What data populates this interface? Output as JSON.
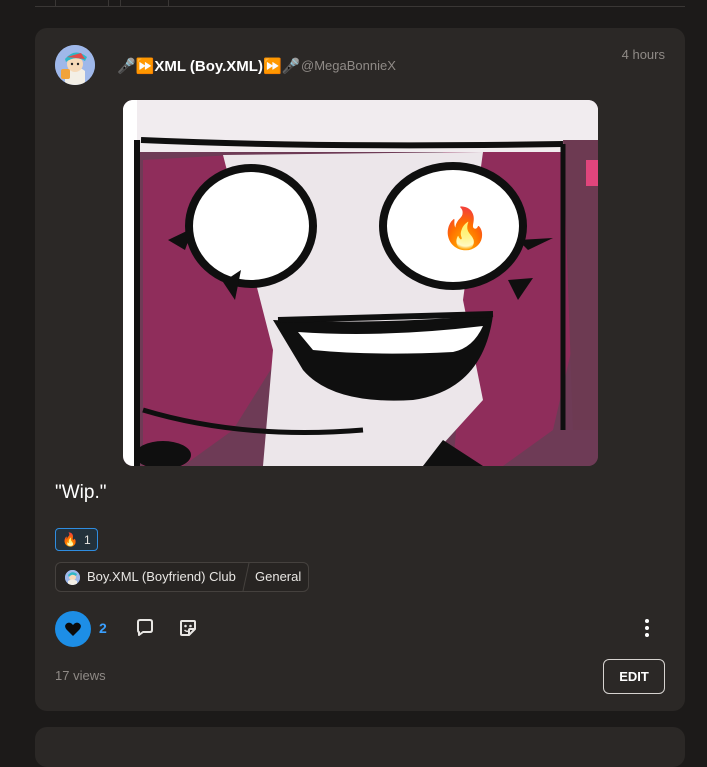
{
  "post": {
    "author_name": "🎤⏩XML (Boy.XML)⏩🎤",
    "author_handle": "@MegaBonnieX",
    "time_ago": "4 hours",
    "caption": "\"Wip.\"",
    "reaction": {
      "emoji": "🔥",
      "count": "1"
    },
    "community": {
      "name": "Boy.XML (Boyfriend) Club",
      "category": "General"
    },
    "likes": "2",
    "views": "17 views",
    "edit_label": "EDIT"
  },
  "colors": {
    "background": "#1c1a19",
    "card": "#2b2826",
    "accent_blue": "#1d8ee6",
    "like_count": "#3aa0ff",
    "muted_text": "#8f8a86"
  },
  "icons": {
    "like": "heart-icon",
    "comment": "comment-icon",
    "sticker": "sticker-icon",
    "more": "more-vertical-icon"
  }
}
